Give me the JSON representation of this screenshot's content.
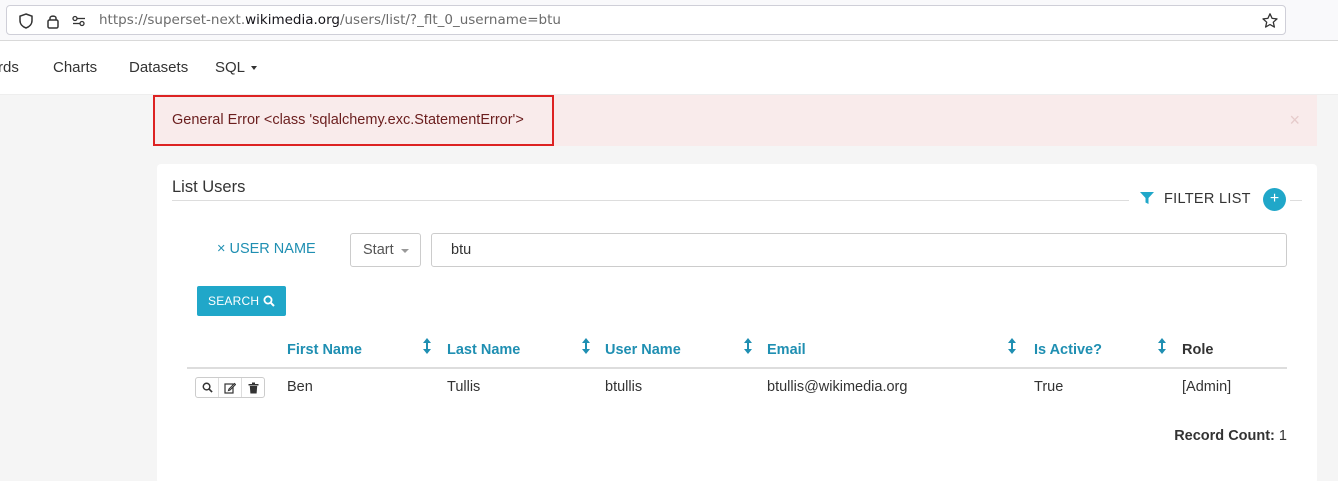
{
  "browser": {
    "url_prefix": "https://superset-next.",
    "url_host": "wikimedia.org",
    "url_path": "/users/list/?_flt_0_username=btu"
  },
  "nav": {
    "items": [
      "rds",
      "Charts",
      "Datasets",
      "SQL"
    ]
  },
  "alert": {
    "message": "General Error <class 'sqlalchemy.exc.StatementError'>",
    "close": "×"
  },
  "panel": {
    "title": "List Users",
    "filter_list_label": "FILTER LIST",
    "add_label": "+"
  },
  "filter": {
    "remove_label": "× USER NAME",
    "operator": "Start",
    "value": "btu",
    "search_label": "SEARCH"
  },
  "table": {
    "columns": [
      "First Name",
      "Last Name",
      "User Name",
      "Email",
      "Is Active?",
      "Role"
    ],
    "rows": [
      {
        "first_name": "Ben",
        "last_name": "Tullis",
        "user_name": "btullis",
        "email": "btullis@wikimedia.org",
        "is_active": "True",
        "role": "[Admin]"
      }
    ],
    "record_count_label": "Record Count:",
    "record_count": "1"
  },
  "colors": {
    "accent": "#20a7c9",
    "link": "#1f8fb2",
    "alert_bg": "#f9ebeb",
    "alert_text": "#6b1e1e",
    "highlight_border": "#dd2222"
  },
  "icons": [
    "shield-icon",
    "lock-icon",
    "permissions-icon",
    "star-icon",
    "funnel-icon",
    "search-icon",
    "edit-icon",
    "trash-icon",
    "sort-icon"
  ]
}
